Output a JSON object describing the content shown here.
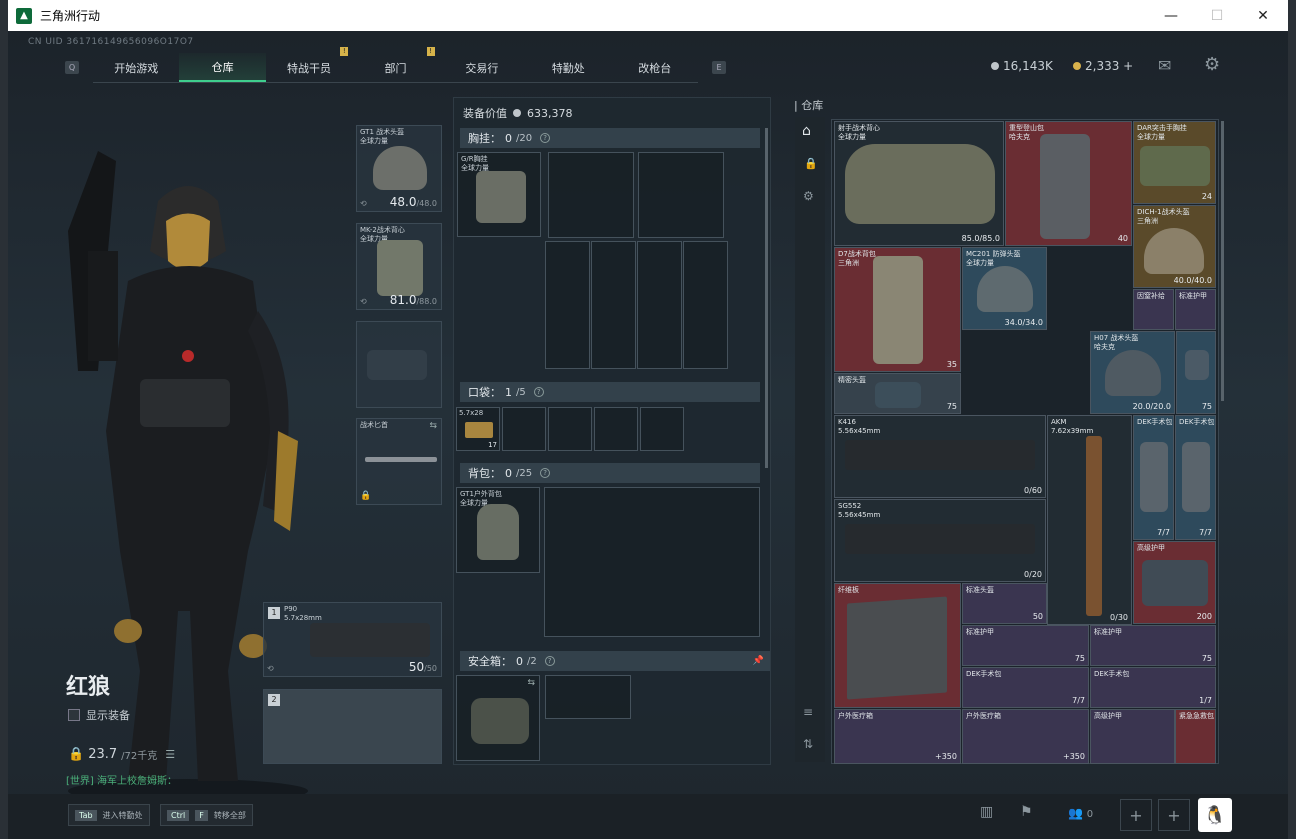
{
  "window": {
    "title": "三角洲行动",
    "minimize": "—",
    "maximize": "☐",
    "close": "✕"
  },
  "uid": "CN UID 361716149656096O17O7",
  "nav": {
    "tabs": [
      {
        "label": "开始游戏"
      },
      {
        "label": "仓库",
        "active": true
      },
      {
        "label": "特战干员",
        "badge": "!"
      },
      {
        "label": "部门",
        "badge": "!"
      },
      {
        "label": "交易行"
      },
      {
        "label": "特勤处"
      },
      {
        "label": "改枪台"
      }
    ],
    "left_key": "Q",
    "right_key": "E"
  },
  "currency": {
    "silver": "16,143K",
    "gold": "2,333 +"
  },
  "character": {
    "name": "红狼",
    "show_gear": "显示装备",
    "weight": "23.7",
    "weight_max": "/72千克",
    "chat": "[世界] 海军上校詹姆斯："
  },
  "gear_slots": [
    {
      "name": "GT1 战术头盔",
      "sub": "全球力量",
      "value": "48.0",
      "max": "/48.0"
    },
    {
      "name": "MK-2战术背心",
      "sub": "全球力量",
      "value": "81.0",
      "max": "/88.0"
    },
    {
      "name": "",
      "sub": "",
      "value": "",
      "max": ""
    },
    {
      "name": "战术匕首",
      "sub": "",
      "value": "",
      "max": ""
    }
  ],
  "weapons": [
    {
      "index": "1",
      "name": "P90",
      "caliber": "5.7x28mm",
      "ammo": "50",
      "ammo_max": "/50"
    },
    {
      "index": "2",
      "name": "",
      "caliber": "",
      "ammo": "",
      "ammo_max": ""
    }
  ],
  "loadout": {
    "equip_value_label": "装备价值",
    "equip_value": "633,378",
    "chest": {
      "label": "胸挂：",
      "count": "0",
      "max": "/20",
      "item": "G/R胸挂",
      "item_sub": "全球力量"
    },
    "pocket": {
      "label": "口袋：",
      "count": "1",
      "max": "/5",
      "item": "5.7x28",
      "item_count": "17"
    },
    "backpack": {
      "label": "背包：",
      "count": "0",
      "max": "/25",
      "item": "GT1户外背包",
      "item_sub": "全球力量"
    },
    "safebox": {
      "label": "安全箱：",
      "count": "0",
      "max": "/2"
    }
  },
  "stash": {
    "label": "仓库",
    "items": [
      {
        "name": "射手战术背心",
        "sub": "全球力量",
        "v": "85.0/85.0"
      },
      {
        "name": "重型登山包",
        "sub": "哈夫克",
        "v": "40"
      },
      {
        "name": "DAR突击手胸挂",
        "sub": "全球力量",
        "v": "24"
      },
      {
        "name": "DICH-1战术头盔",
        "sub": "三角洲",
        "v": "40.0/40.0"
      },
      {
        "name": "D7战术背包",
        "sub": "三角洲",
        "v": "35"
      },
      {
        "name": "MC201 防弹头盔",
        "sub": "全球力量",
        "v": "34.0/34.0"
      },
      {
        "name": "因窒补给",
        "sub": "",
        "v": ""
      },
      {
        "name": "标准护甲",
        "sub": "",
        "v": ""
      },
      {
        "name": "精密头盔",
        "sub": "",
        "v": "75"
      },
      {
        "name": "H07 战术头盔",
        "sub": "哈夫克",
        "v": "20.0/20.0"
      },
      {
        "name": "",
        "sub": "",
        "v": "75"
      },
      {
        "name": "K416",
        "sub": "5.56x45mm",
        "v": "0/60"
      },
      {
        "name": "AKM",
        "sub": "7.62x39mm",
        "v": "0/30"
      },
      {
        "name": "DEK手术包",
        "sub": "",
        "v": "7/7"
      },
      {
        "name": "DEK手术包",
        "sub": "",
        "v": "7/7"
      },
      {
        "name": "SG552",
        "sub": "5.56x45mm",
        "v": "0/20"
      },
      {
        "name": "高级护甲",
        "sub": "",
        "v": "200"
      },
      {
        "name": "纤维板",
        "sub": "",
        "v": ""
      },
      {
        "name": "标准头盔",
        "sub": "",
        "v": "50"
      },
      {
        "name": "标准护甲",
        "sub": "",
        "v": "75"
      },
      {
        "name": "标准护甲",
        "sub": "",
        "v": "75"
      },
      {
        "name": "DEK手术包",
        "sub": "",
        "v": "7/7"
      },
      {
        "name": "DEK手术包",
        "sub": "",
        "v": "1/7"
      },
      {
        "name": "户外医疗箱",
        "sub": "",
        "v": "+350"
      },
      {
        "name": "户外医疗箱",
        "sub": "",
        "v": "+350"
      },
      {
        "name": "高级护甲",
        "sub": "",
        "v": ""
      },
      {
        "name": "紧急急救包",
        "sub": "",
        "v": ""
      }
    ]
  },
  "bottom": {
    "tab_key": "Tab",
    "tab_label": "进入特勤处",
    "ctrl_key": "Ctrl",
    "f_key": "F",
    "ctrl_label": "转移全部",
    "friends": "0"
  }
}
